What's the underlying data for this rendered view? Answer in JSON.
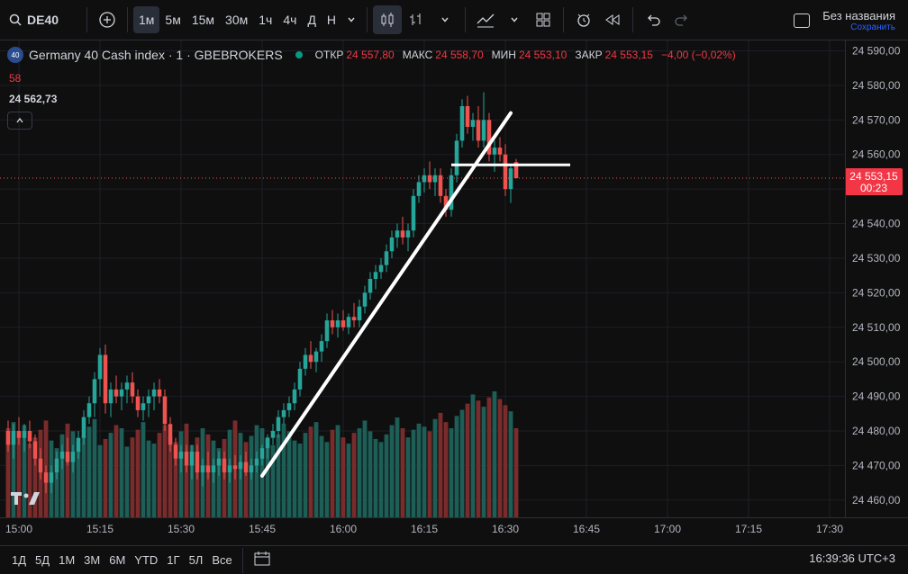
{
  "toolbar": {
    "symbol": "DE40",
    "intervals": [
      "1м",
      "5м",
      "15м",
      "30м",
      "1ч",
      "4ч",
      "Д",
      "Н"
    ],
    "active_interval": "1м"
  },
  "layout": {
    "name": "Без названия",
    "status": "Сохранить"
  },
  "legend": {
    "badge": "40",
    "title": "Germany 40 Cash index · 1 · GBEBROKERS",
    "open_label": "ОТКР",
    "open": "24 557,80",
    "high_label": "МАКС",
    "high": "24 558,70",
    "low_label": "МИН",
    "low": "24 553,10",
    "close_label": "ЗАКР",
    "close": "24 553,15",
    "change": "−4,00 (−0,02%)",
    "volume": "58",
    "crosshair_price": "24 562,73"
  },
  "price_axis": {
    "ticks": [
      "24 590,00",
      "24 580,00",
      "24 570,00",
      "24 560,00",
      "24 550,00",
      "24 540,00",
      "24 530,00",
      "24 520,00",
      "24 510,00",
      "24 500,00",
      "24 490,00",
      "24 480,00",
      "24 470,00",
      "24 460,00"
    ],
    "current_price": "24 553,15",
    "countdown": "00:23"
  },
  "time_axis": {
    "ticks": [
      "15:00",
      "15:15",
      "15:30",
      "15:45",
      "16:00",
      "16:15",
      "16:30",
      "16:45",
      "17:00",
      "17:15",
      "17:30"
    ]
  },
  "bottombar": {
    "ranges": [
      "1Д",
      "5Д",
      "1М",
      "3М",
      "6М",
      "YTD",
      "1Г",
      "5Л",
      "Все"
    ],
    "clock": "16:39:36 UTC+3"
  },
  "colors": {
    "up": "#26a69a",
    "down": "#ef5350",
    "vol_up": "#1d5e57",
    "vol_down": "#7a2c2c",
    "bg": "#0f0f0f",
    "grid": "#1c1f26"
  },
  "chart_data": {
    "type": "candlestick",
    "ylim": [
      24455,
      24593
    ],
    "x_start": "15:00",
    "x_end": "17:30",
    "candles": [
      [
        24480,
        24483,
        24474,
        24476
      ],
      [
        24476,
        24482,
        24472,
        24480
      ],
      [
        24480,
        24484,
        24476,
        24478
      ],
      [
        24478,
        24482,
        24474,
        24480
      ],
      [
        24480,
        24483,
        24475,
        24477
      ],
      [
        24477,
        24479,
        24470,
        24472
      ],
      [
        24472,
        24475,
        24466,
        24468
      ],
      [
        24468,
        24470,
        24462,
        24465
      ],
      [
        24465,
        24470,
        24462,
        24468
      ],
      [
        24468,
        24474,
        24466,
        24472
      ],
      [
        24472,
        24476,
        24469,
        24474
      ],
      [
        24474,
        24478,
        24470,
        24471
      ],
      [
        24471,
        24476,
        24468,
        24474
      ],
      [
        24474,
        24480,
        24472,
        24478
      ],
      [
        24478,
        24486,
        24476,
        24484
      ],
      [
        24484,
        24490,
        24482,
        24488
      ],
      [
        24488,
        24497,
        24484,
        24495
      ],
      [
        24495,
        24504,
        24490,
        24502
      ],
      [
        24502,
        24505,
        24485,
        24488
      ],
      [
        24488,
        24494,
        24484,
        24492
      ],
      [
        24492,
        24496,
        24488,
        24490
      ],
      [
        24490,
        24494,
        24486,
        24492
      ],
      [
        24492,
        24496,
        24488,
        24494
      ],
      [
        24494,
        24497,
        24488,
        24490
      ],
      [
        24490,
        24492,
        24484,
        24486
      ],
      [
        24486,
        24490,
        24483,
        24488
      ],
      [
        24488,
        24492,
        24484,
        24490
      ],
      [
        24490,
        24494,
        24486,
        24492
      ],
      [
        24492,
        24495,
        24488,
        24490
      ],
      [
        24490,
        24492,
        24480,
        24482
      ],
      [
        24482,
        24484,
        24474,
        24476
      ],
      [
        24476,
        24478,
        24470,
        24472
      ],
      [
        24472,
        24476,
        24468,
        24474
      ],
      [
        24474,
        24476,
        24468,
        24470
      ],
      [
        24470,
        24476,
        24466,
        24474
      ],
      [
        24474,
        24476,
        24466,
        24468
      ],
      [
        24468,
        24472,
        24464,
        24470
      ],
      [
        24470,
        24474,
        24466,
        24468
      ],
      [
        24468,
        24472,
        24465,
        24470
      ],
      [
        24470,
        24474,
        24467,
        24472
      ],
      [
        24472,
        24474,
        24466,
        24468
      ],
      [
        24468,
        24472,
        24465,
        24470
      ],
      [
        24470,
        24473,
        24466,
        24469
      ],
      [
        24469,
        24473,
        24466,
        24471
      ],
      [
        24471,
        24474,
        24467,
        24468
      ],
      [
        24468,
        24472,
        24466,
        24470
      ],
      [
        24470,
        24474,
        24468,
        24472
      ],
      [
        24472,
        24476,
        24470,
        24475
      ],
      [
        24475,
        24479,
        24472,
        24478
      ],
      [
        24478,
        24482,
        24476,
        24480
      ],
      [
        24480,
        24486,
        24478,
        24484
      ],
      [
        24484,
        24488,
        24482,
        24486
      ],
      [
        24486,
        24490,
        24484,
        24488
      ],
      [
        24488,
        24494,
        24486,
        24492
      ],
      [
        24492,
        24500,
        24490,
        24498
      ],
      [
        24498,
        24504,
        24496,
        24502
      ],
      [
        24502,
        24506,
        24498,
        24500
      ],
      [
        24500,
        24504,
        24497,
        24503
      ],
      [
        24503,
        24508,
        24500,
        24506
      ],
      [
        24506,
        24514,
        24504,
        24512
      ],
      [
        24512,
        24515,
        24508,
        24510
      ],
      [
        24510,
        24514,
        24507,
        24512
      ],
      [
        24512,
        24515,
        24509,
        24510
      ],
      [
        24510,
        24514,
        24508,
        24513
      ],
      [
        24513,
        24517,
        24510,
        24512
      ],
      [
        24512,
        24518,
        24510,
        24516
      ],
      [
        24516,
        24522,
        24514,
        24520
      ],
      [
        24520,
        24526,
        24518,
        24524
      ],
      [
        24524,
        24528,
        24521,
        24526
      ],
      [
        24526,
        24530,
        24524,
        24528
      ],
      [
        24528,
        24534,
        24526,
        24532
      ],
      [
        24532,
        24538,
        24530,
        24536
      ],
      [
        24536,
        24540,
        24533,
        24538
      ],
      [
        24538,
        24542,
        24534,
        24536
      ],
      [
        24536,
        24540,
        24532,
        24538
      ],
      [
        24538,
        24550,
        24536,
        24548
      ],
      [
        24548,
        24554,
        24546,
        24552
      ],
      [
        24552,
        24556,
        24549,
        24554
      ],
      [
        24554,
        24558,
        24550,
        24552
      ],
      [
        24552,
        24556,
        24548,
        24554
      ],
      [
        24554,
        24556,
        24546,
        24548
      ],
      [
        24548,
        24550,
        24542,
        24544
      ],
      [
        24544,
        24556,
        24542,
        24554
      ],
      [
        24554,
        24566,
        24552,
        24564
      ],
      [
        24564,
        24576,
        24562,
        24574
      ],
      [
        24574,
        24577,
        24566,
        24568
      ],
      [
        24568,
        24572,
        24564,
        24570
      ],
      [
        24570,
        24574,
        24562,
        24564
      ],
      [
        24564,
        24578,
        24562,
        24570
      ],
      [
        24570,
        24572,
        24558,
        24560
      ],
      [
        24560,
        24564,
        24555,
        24562
      ],
      [
        24562,
        24565,
        24558,
        24560
      ],
      [
        24560,
        24563,
        24548,
        24550
      ],
      [
        24550,
        24557,
        24546,
        24556
      ],
      [
        24557.8,
        24558.7,
        24553.1,
        24553.15
      ]
    ],
    "volumes": [
      58,
      62,
      55,
      60,
      48,
      52,
      57,
      63,
      50,
      45,
      54,
      61,
      56,
      49,
      53,
      59,
      64,
      47,
      51,
      55,
      60,
      58,
      46,
      52,
      57,
      62,
      50,
      48,
      55,
      60,
      53,
      49,
      56,
      61,
      47,
      52,
      58,
      54,
      50,
      45,
      51,
      57,
      63,
      55,
      49,
      53,
      60,
      58,
      52,
      47,
      54,
      61,
      56,
      50,
      48,
      55,
      59,
      62,
      53,
      49,
      57,
      60,
      52,
      48,
      55,
      58,
      63,
      56,
      51,
      49,
      54,
      60,
      65,
      58,
      52,
      57,
      61,
      59,
      56,
      64,
      68,
      62,
      58,
      66,
      70,
      74,
      80,
      76,
      72,
      78,
      82,
      77,
      73,
      69,
      58
    ],
    "annotations": {
      "trend_line": {
        "from": [
          "15:45",
          24467
        ],
        "to": [
          "16:31",
          24572
        ]
      },
      "horizontal_segment": {
        "from": [
          "16:20",
          24557
        ],
        "to": [
          "16:42",
          24557
        ]
      }
    }
  }
}
